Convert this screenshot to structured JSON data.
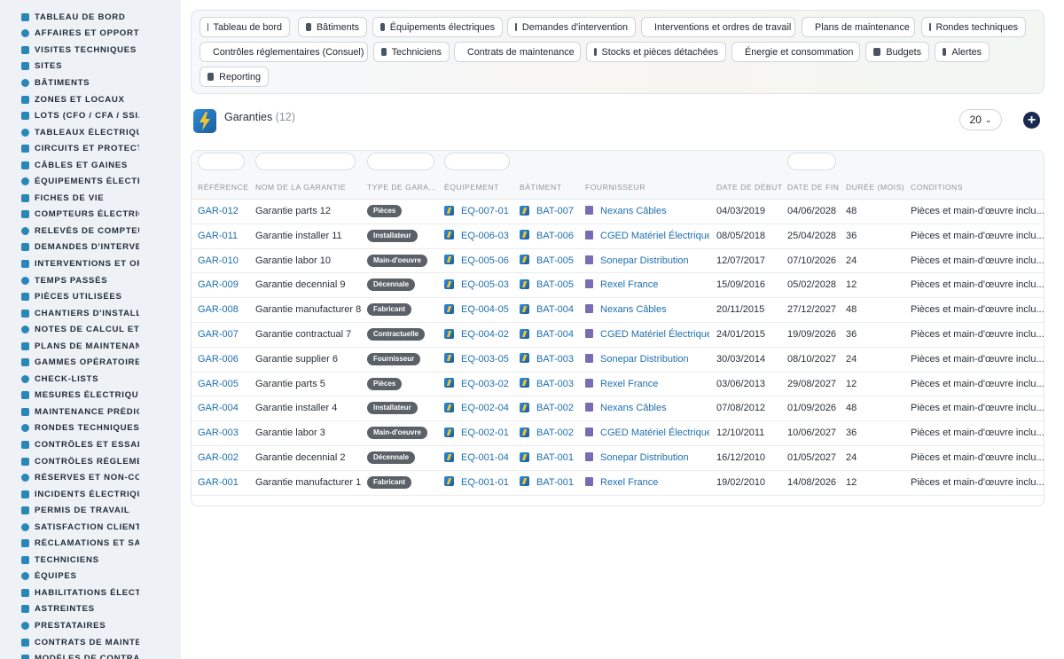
{
  "sidebar": {
    "items": [
      {
        "label": "TABLEAU DE BORD",
        "icon": "dashboard-icon"
      },
      {
        "label": "AFFAIRES ET OPPORTUN",
        "icon": "target-icon"
      },
      {
        "label": "VISITES TECHNIQUES ET",
        "icon": "clipboard-icon"
      },
      {
        "label": "SITES",
        "icon": "location-pin-icon"
      },
      {
        "label": "BÂTIMENTS",
        "icon": "building-icon"
      },
      {
        "label": "ZONES ET LOCAUX",
        "icon": "door-icon"
      },
      {
        "label": "LOTS (CFO / CFA / SSI...)",
        "icon": "hierarchy-icon"
      },
      {
        "label": "TABLEAUX ÉLECTRIQUES",
        "icon": "table-icon"
      },
      {
        "label": "CIRCUITS ET PROTECTIO",
        "icon": "plug-icon"
      },
      {
        "label": "CÂBLES ET GAINES",
        "icon": "cable-icon"
      },
      {
        "label": "ÉQUIPEMENTS ÉLECTRIQ",
        "icon": "gears-icon"
      },
      {
        "label": "FICHES DE VIE",
        "icon": "history-icon"
      },
      {
        "label": "COMPTEURS ÉLECTRIQU",
        "icon": "gauge-icon"
      },
      {
        "label": "RELEVÉS DE COMPTEURS",
        "icon": "reading-icon"
      },
      {
        "label": "DEMANDES D'INTERVENT",
        "icon": "question-icon"
      },
      {
        "label": "INTERVENTIONS ET ORDI",
        "icon": "wrench-icon"
      },
      {
        "label": "TEMPS PASSÉS",
        "icon": "clock-icon"
      },
      {
        "label": "PIÈCES UTILISÉES",
        "icon": "parts-icon"
      },
      {
        "label": "CHANTIERS D'INSTALLAT",
        "icon": "hammer-icon"
      },
      {
        "label": "NOTES DE CALCUL ET ÉT",
        "icon": "calculator-icon"
      },
      {
        "label": "PLANS DE MAINTENANCE",
        "icon": "calendar-icon"
      },
      {
        "label": "GAMMES OPÉRATOIRES",
        "icon": "list-icon"
      },
      {
        "label": "CHECK-LISTS",
        "icon": "checklist-icon"
      },
      {
        "label": "MESURES ÉLECTRIQUES",
        "icon": "thermometer-icon"
      },
      {
        "label": "MAINTENANCE PRÉDICTI",
        "icon": "chart-line-icon"
      },
      {
        "label": "RONDES TECHNIQUES",
        "icon": "route-icon"
      },
      {
        "label": "CONTRÔLES ET ESSAIS",
        "icon": "search-icon"
      },
      {
        "label": "CONTRÔLES RÉGLEMENT",
        "icon": "document-icon"
      },
      {
        "label": "RÉSERVES ET NON-CONF",
        "icon": "alert-circle-icon"
      },
      {
        "label": "INCIDENTS ÉLECTRIQUES",
        "icon": "warning-icon"
      },
      {
        "label": "PERMIS DE TRAVAIL",
        "icon": "pen-icon"
      },
      {
        "label": "SATISFACTION CLIENT",
        "icon": "smile-icon"
      },
      {
        "label": "RÉCLAMATIONS ET SAV",
        "icon": "comment-icon"
      },
      {
        "label": "TECHNICIENS",
        "icon": "hard-hat-icon"
      },
      {
        "label": "ÉQUIPES",
        "icon": "users-icon"
      },
      {
        "label": "HABILITATIONS ÉLECTRI",
        "icon": "badge-icon"
      },
      {
        "label": "ASTREINTES",
        "icon": "phone-icon"
      },
      {
        "label": "PRESTATAIRES",
        "icon": "handshake-icon"
      },
      {
        "label": "CONTRATS DE MAINTENA",
        "icon": "contract-icon"
      },
      {
        "label": "MODÈLES DE CONTRATS",
        "icon": "template-icon"
      }
    ]
  },
  "topnav": {
    "items": [
      {
        "label": "Tableau de bord",
        "icon": "dashboard-icon"
      },
      {
        "label": "Bâtiments",
        "icon": "building-icon"
      },
      {
        "label": "Équipements électriques",
        "icon": "gears-icon"
      },
      {
        "label": "Demandes d'intervention",
        "icon": "question-icon"
      },
      {
        "label": "Interventions et ordres de travail",
        "icon": "clipboard-icon"
      },
      {
        "label": "Plans de maintenance",
        "icon": "calendar-icon"
      },
      {
        "label": "Rondes techniques",
        "icon": "route-icon"
      },
      {
        "label": "Contrôles réglementaires (Consuel)",
        "icon": "document-icon"
      },
      {
        "label": "Techniciens",
        "icon": "hard-hat-icon"
      },
      {
        "label": "Contrats de maintenance",
        "icon": "contract-icon"
      },
      {
        "label": "Stocks et pièces détachées",
        "icon": "boxes-icon"
      },
      {
        "label": "Énergie et consommation",
        "icon": "bolt-icon"
      },
      {
        "label": "Budgets",
        "icon": "money-icon"
      },
      {
        "label": "Alertes",
        "icon": "bell-icon"
      },
      {
        "label": "Reporting",
        "icon": "pie-chart-icon"
      }
    ]
  },
  "page": {
    "title": "Garanties",
    "count": "(12)",
    "page_size": "20",
    "add_label": "+"
  },
  "table": {
    "columns": [
      "RÉFÉRENCE",
      "NOM DE LA GARANTIE",
      "TYPE DE GARA...",
      "ÉQUIPEMENT",
      "BÂTIMENT",
      "FOURNISSEUR",
      "DATE DE DÉBUT",
      "DATE DE FIN",
      "DURÉE (MOIS)",
      "CONDITIONS"
    ],
    "rows": [
      {
        "ref": "GAR-012",
        "name": "Garantie parts 12",
        "type": "Pièces",
        "equip": "EQ-007-01",
        "bat": "BAT-007",
        "fournisseur": "Nexans Câbles",
        "debut": "04/03/2019",
        "fin": "04/06/2028",
        "duree": "48",
        "conditions": "Pièces et main-d'œuvre inclu..."
      },
      {
        "ref": "GAR-011",
        "name": "Garantie installer 11",
        "type": "Installateur",
        "equip": "EQ-006-03",
        "bat": "BAT-006",
        "fournisseur": "CGED Matériel Électrique",
        "debut": "08/05/2018",
        "fin": "25/04/2028",
        "duree": "36",
        "conditions": "Pièces et main-d'œuvre inclu..."
      },
      {
        "ref": "GAR-010",
        "name": "Garantie labor 10",
        "type": "Main-d'oeuvre",
        "equip": "EQ-005-06",
        "bat": "BAT-005",
        "fournisseur": "Sonepar Distribution",
        "debut": "12/07/2017",
        "fin": "07/10/2026",
        "duree": "24",
        "conditions": "Pièces et main-d'œuvre inclu..."
      },
      {
        "ref": "GAR-009",
        "name": "Garantie decennial 9",
        "type": "Décennale",
        "equip": "EQ-005-03",
        "bat": "BAT-005",
        "fournisseur": "Rexel France",
        "debut": "15/09/2016",
        "fin": "05/02/2028",
        "duree": "12",
        "conditions": "Pièces et main-d'œuvre inclu..."
      },
      {
        "ref": "GAR-008",
        "name": "Garantie manufacturer 8",
        "type": "Fabricant",
        "equip": "EQ-004-05",
        "bat": "BAT-004",
        "fournisseur": "Nexans Câbles",
        "debut": "20/11/2015",
        "fin": "27/12/2027",
        "duree": "48",
        "conditions": "Pièces et main-d'œuvre inclu..."
      },
      {
        "ref": "GAR-007",
        "name": "Garantie contractual 7",
        "type": "Contractuelle",
        "equip": "EQ-004-02",
        "bat": "BAT-004",
        "fournisseur": "CGED Matériel Électrique",
        "debut": "24/01/2015",
        "fin": "19/09/2026",
        "duree": "36",
        "conditions": "Pièces et main-d'œuvre inclu..."
      },
      {
        "ref": "GAR-006",
        "name": "Garantie supplier 6",
        "type": "Fournisseur",
        "equip": "EQ-003-05",
        "bat": "BAT-003",
        "fournisseur": "Sonepar Distribution",
        "debut": "30/03/2014",
        "fin": "08/10/2027",
        "duree": "24",
        "conditions": "Pièces et main-d'œuvre inclu..."
      },
      {
        "ref": "GAR-005",
        "name": "Garantie parts 5",
        "type": "Pièces",
        "equip": "EQ-003-02",
        "bat": "BAT-003",
        "fournisseur": "Rexel France",
        "debut": "03/06/2013",
        "fin": "29/08/2027",
        "duree": "12",
        "conditions": "Pièces et main-d'œuvre inclu..."
      },
      {
        "ref": "GAR-004",
        "name": "Garantie installer 4",
        "type": "Installateur",
        "equip": "EQ-002-04",
        "bat": "BAT-002",
        "fournisseur": "Nexans Câbles",
        "debut": "07/08/2012",
        "fin": "01/09/2026",
        "duree": "48",
        "conditions": "Pièces et main-d'œuvre inclu..."
      },
      {
        "ref": "GAR-003",
        "name": "Garantie labor 3",
        "type": "Main-d'oeuvre",
        "equip": "EQ-002-01",
        "bat": "BAT-002",
        "fournisseur": "CGED Matériel Électrique",
        "debut": "12/10/2011",
        "fin": "10/06/2027",
        "duree": "36",
        "conditions": "Pièces et main-d'œuvre inclu..."
      },
      {
        "ref": "GAR-002",
        "name": "Garantie decennial 2",
        "type": "Décennale",
        "equip": "EQ-001-04",
        "bat": "BAT-001",
        "fournisseur": "Sonepar Distribution",
        "debut": "16/12/2010",
        "fin": "01/05/2027",
        "duree": "24",
        "conditions": "Pièces et main-d'œuvre inclu..."
      },
      {
        "ref": "GAR-001",
        "name": "Garantie manufacturer 1",
        "type": "Fabricant",
        "equip": "EQ-001-01",
        "bat": "BAT-001",
        "fournisseur": "Rexel France",
        "debut": "19/02/2010",
        "fin": "14/08/2026",
        "duree": "12",
        "conditions": "Pièces et main-d'œuvre inclu..."
      }
    ]
  },
  "colors": {
    "accent": "#1e6fae",
    "sidebar_bg": "#eef2f7",
    "badge_bg": "#5b6168",
    "add_button": "#1b2a4e"
  }
}
